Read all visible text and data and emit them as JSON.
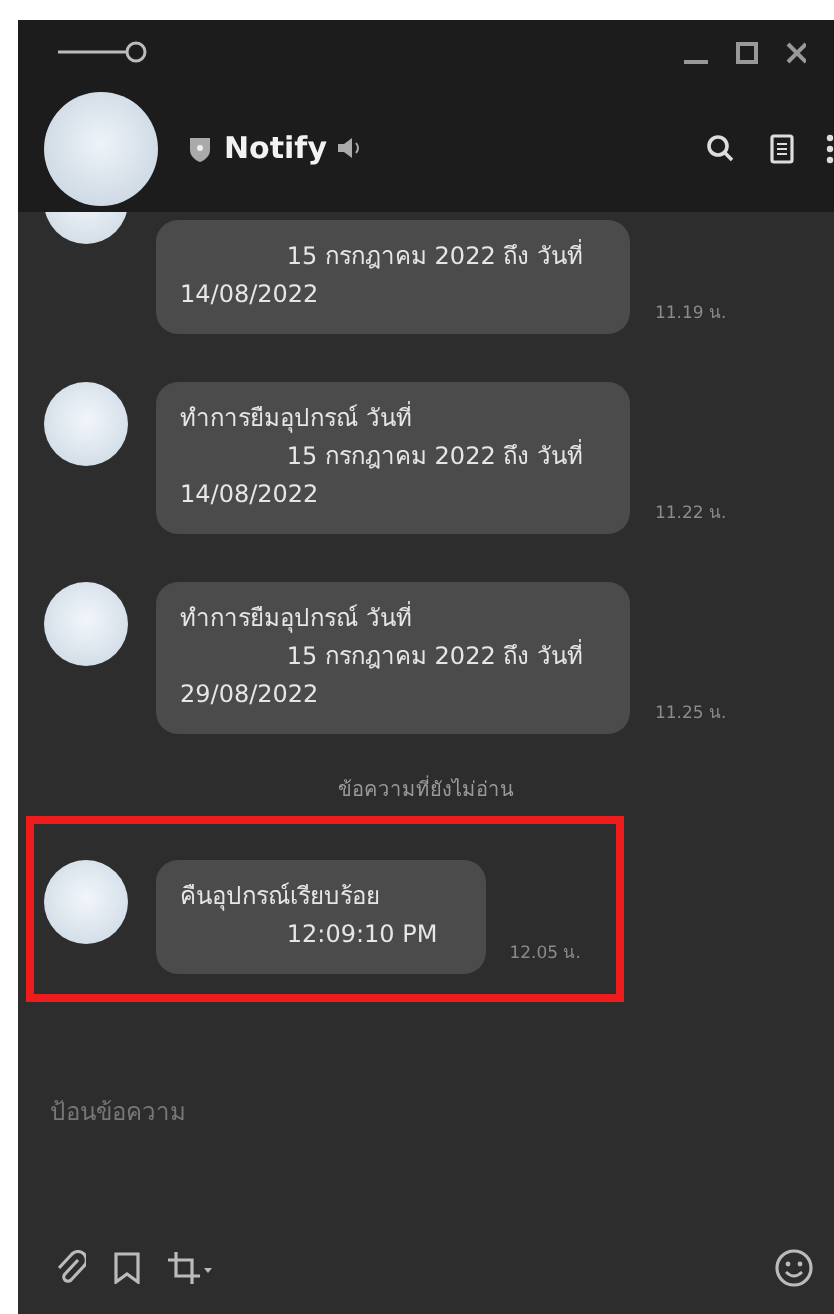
{
  "header": {
    "title": "Notify"
  },
  "messages": [
    {
      "kind": "message",
      "partial": true,
      "highlighted": false,
      "text": "              15 กรกฎาคม 2022 ถึง วันที่\n14/08/2022",
      "time": "11.19 น."
    },
    {
      "kind": "message",
      "partial": false,
      "highlighted": false,
      "text": "ทำการยืมอุปกรณ์ วันที่\n              15 กรกฎาคม 2022 ถึง วันที่\n14/08/2022",
      "time": "11.22 น."
    },
    {
      "kind": "message",
      "partial": false,
      "highlighted": false,
      "text": "ทำการยืมอุปกรณ์ วันที่\n              15 กรกฎาคม 2022 ถึง วันที่\n29/08/2022",
      "time": "11.25 น."
    },
    {
      "kind": "divider",
      "text": "ข้อความที่ยังไม่อ่าน"
    },
    {
      "kind": "message",
      "partial": false,
      "highlighted": true,
      "text": "คืนอุปกรณ์เรียบร้อย\n              12:09:10 PM",
      "time": "12.05 น."
    }
  ],
  "composer": {
    "placeholder": "ป้อนข้อความ"
  }
}
